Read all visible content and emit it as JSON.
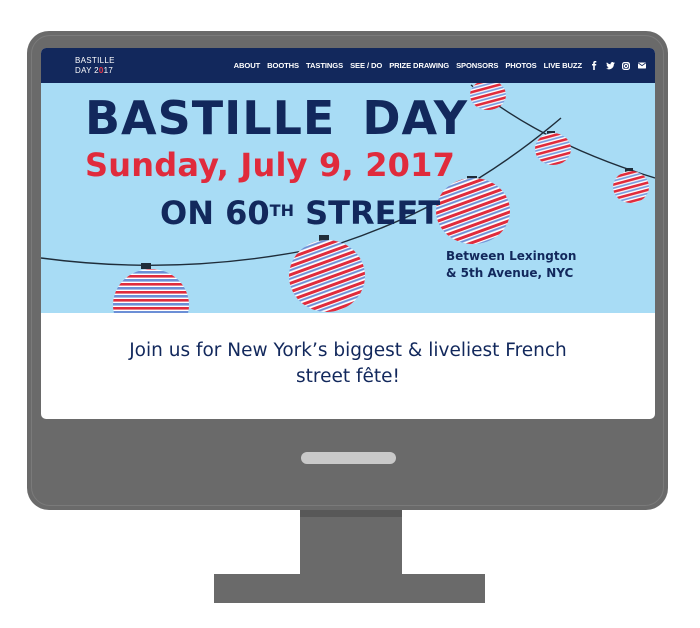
{
  "logo": {
    "line1": "BASTILLE",
    "line2_prefix": "DAY 2",
    "line2_accent": "0",
    "line2_suffix": "17"
  },
  "nav": {
    "items": [
      {
        "label": "ABOUT"
      },
      {
        "label": "BOOTHS"
      },
      {
        "label": "TASTINGS"
      },
      {
        "label": "SEE / DO"
      },
      {
        "label": "PRIZE DRAWING"
      },
      {
        "label": "SPONSORS"
      },
      {
        "label": "PHOTOS"
      },
      {
        "label": "LIVE BUZZ"
      }
    ],
    "social": [
      {
        "icon": "facebook-icon",
        "glyph": "f"
      },
      {
        "icon": "twitter-icon",
        "glyph": "t"
      },
      {
        "icon": "instagram-icon",
        "glyph": ""
      },
      {
        "icon": "email-icon",
        "glyph": ""
      }
    ]
  },
  "hero": {
    "title": "BASTILLE DAY",
    "date": "Sunday, July 9, 2017",
    "street_prefix": "ON 60",
    "street_sup": "TH",
    "street_suffix": " STREET",
    "location_line1": "Between Lexington",
    "location_line2": "& 5th Avenue, NYC"
  },
  "body": {
    "tagline": "Join us for New York’s biggest & liveliest French street fête!"
  },
  "colors": {
    "navy": "#12285c",
    "red": "#e02b3c",
    "sky": "#a8dcf5",
    "monitor": "#6a6a6a"
  }
}
